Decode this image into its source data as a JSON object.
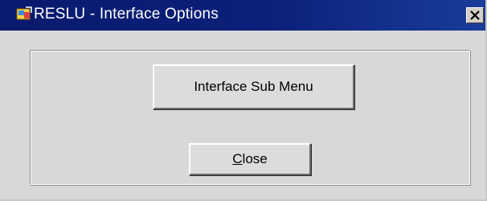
{
  "window": {
    "title": "RESLU - Interface Options",
    "icon": "app-icon",
    "close_icon": "close-icon"
  },
  "buttons": {
    "interface_sub_menu": "Interface Sub Menu",
    "close_mnemonic": "C",
    "close_rest": "lose"
  },
  "colors": {
    "titlebar": "#0b2079",
    "window_bg": "#d8d8d8",
    "button_bg": "#dcdcdc"
  }
}
